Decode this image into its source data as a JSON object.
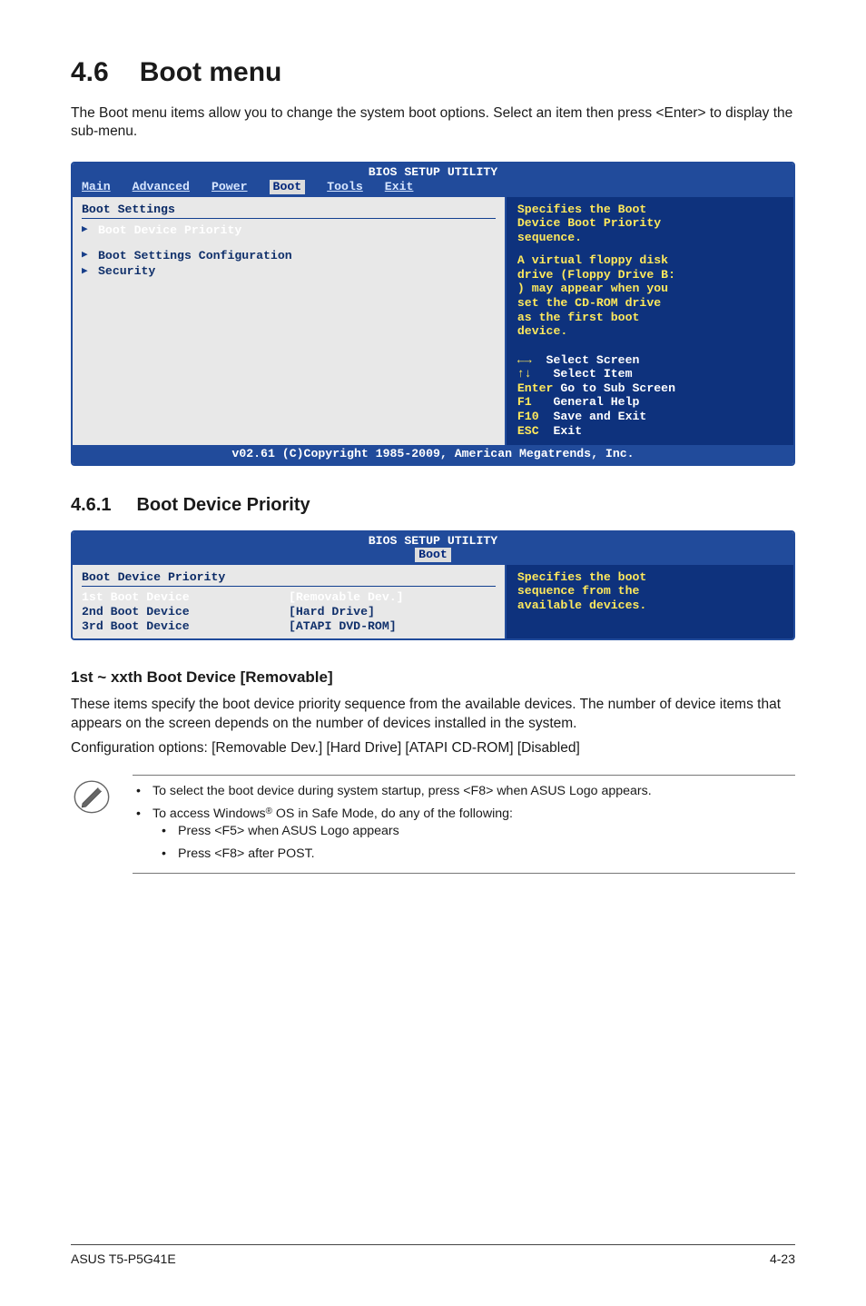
{
  "section": {
    "num": "4.6",
    "title": "Boot menu"
  },
  "intro": "The Boot menu items allow you to change the system boot options. Select an item then press <Enter> to display the sub-menu.",
  "bios1": {
    "header": "BIOS SETUP UTILITY",
    "tabs": [
      "Main",
      "Advanced",
      "Power",
      "Boot",
      "Tools",
      "Exit"
    ],
    "active_tab": "Boot",
    "group_title": "Boot Settings",
    "items": [
      "Boot Device Priority",
      "Boot Settings Configuration",
      "Security"
    ],
    "right": {
      "desc1a": "Specifies the Boot",
      "desc1b": "Device Boot Priority",
      "desc1c": "sequence.",
      "desc2a": "A virtual floppy disk",
      "desc2b": "drive (Floppy Drive B:",
      "desc2c": ") may appear when you",
      "desc2d": "set the CD-ROM drive",
      "desc2e": "as the first boot",
      "desc2f": "device.",
      "nav1": "Select Screen",
      "nav2": "Select Item",
      "nav3a": "Enter",
      "nav3b": "Go to Sub Screen",
      "nav4a": "F1",
      "nav4b": "General Help",
      "nav5a": "F10",
      "nav5b": "Save and Exit",
      "nav6a": "ESC",
      "nav6b": "Exit"
    },
    "footer": "v02.61 (C)Copyright 1985-2009, American Megatrends, Inc."
  },
  "subsection": {
    "num": "4.6.1",
    "title": "Boot Device Priority"
  },
  "bios2": {
    "header": "BIOS SETUP UTILITY",
    "active_tab": "Boot",
    "group_title": "Boot Device Priority",
    "rows": [
      {
        "label": "1st Boot Device",
        "value": "[Removable Dev.]"
      },
      {
        "label": "2nd Boot Device",
        "value": "[Hard Drive]"
      },
      {
        "label": "3rd Boot Device",
        "value": "[ATAPI DVD-ROM]"
      }
    ],
    "right": {
      "l1": "Specifies the boot",
      "l2": "sequence from the",
      "l3": "available devices."
    }
  },
  "option": {
    "heading": "1st ~ xxth Boot Device [Removable]",
    "p1": "These items specify the boot device priority sequence from the available devices. The number of device items that appears on the screen depends on the number of devices installed in the system.",
    "p2": "Configuration options: [Removable Dev.] [Hard Drive] [ATAPI CD-ROM] [Disabled]"
  },
  "note": {
    "b1": "To select the boot device during system startup, press <F8> when ASUS Logo appears.",
    "b2a": "To access Windows",
    "b2b": " OS in Safe Mode, do any of the following:",
    "s1": "Press <F5> when ASUS Logo appears",
    "s2": "Press <F8> after POST."
  },
  "footer": {
    "left": "ASUS T5-P5G41E",
    "right": "4-23"
  }
}
